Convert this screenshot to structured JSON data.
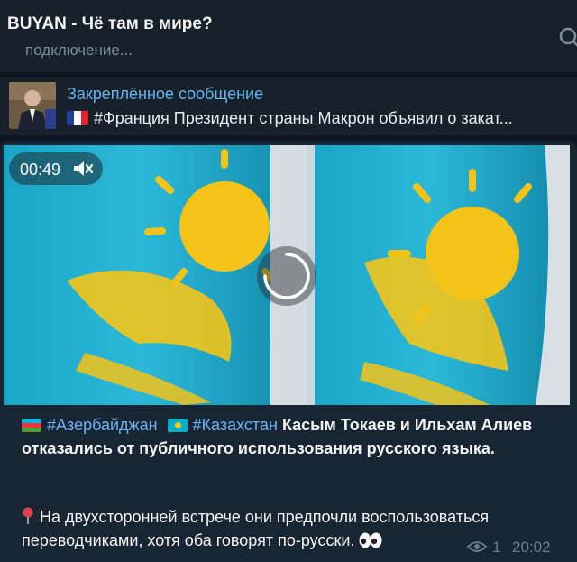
{
  "header": {
    "title": "BUYAN - Чё там в мире?",
    "status": "подключение..."
  },
  "pinned": {
    "title": "Закреплённое сообщение",
    "text": "#Франция Президент страны Макрон объявил о закат..."
  },
  "message": {
    "video": {
      "duration": "00:49",
      "muted": true
    },
    "hashtags": [
      "#Азербайджан",
      "#Казахстан"
    ],
    "headline": "Касым Токаев и Ильхам Алиев отказались от публичного использования русского языка.",
    "body": "На двухсторонней встрече они предпочли воспользоваться переводчиками, хотя оба говорят по-русски.",
    "views": "1",
    "time": "20:02"
  },
  "icons": {
    "search": "search-icon",
    "mute": "speaker-muted-icon",
    "views": "eye-icon",
    "pin": "pushpin-emoji",
    "eyes": "eyes-emoji"
  },
  "colors": {
    "background": "#0e1621",
    "header": "#17212b",
    "bubble": "#182533",
    "link": "#6ab3f3",
    "accent": "#64b5ef"
  }
}
